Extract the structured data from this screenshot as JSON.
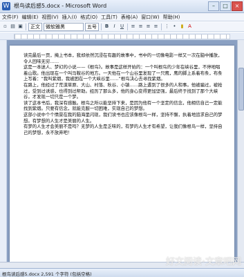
{
  "window": {
    "title": "根鸟读后感5.docx - Microsoft Word",
    "controls": [
      "–",
      "□",
      "×"
    ]
  },
  "menu": [
    "文件(F)",
    "编辑(E)",
    "视图(V)",
    "插入(I)",
    "格式(O)",
    "工具(T)",
    "表格(A)",
    "窗口(W)",
    "帮助(H)"
  ],
  "toolbar": {
    "style_combo": "正文",
    "font_combo": "微软雅黑",
    "size_combo": "五号"
  },
  "document": {
    "paragraphs": [
      "读完最后一页，掩上书本，我却依然沉浸在有趣的故事中，书中的一切像电影一样又一次在脑中播放，令人回味无穷……",
      "这是一本迷人、梦幻的小说——《根鸟》。故事是这样开始的：一个叫根鸟的少年在峡谷里，不停地唱着山歌。他出现在一个叫马鞍谷的地方。一天他在一个山谷里发现了一只鹰，鹰的脚上系着布条，布条上写着：“我叫紫烟，我被困在一个大峡谷里……”根鸟决心去寻找紫烟。",
      "在路上，他经过了荒漠草原、大山、村落、秋谷、小镇……路上遇到了很多的人和事。他被骗过，被抢过，受到过诱惑，也得到过帮助。经历了那么多，他的身心变得更加坚强，最后终于找到了那个大峡谷，才发现一切只是一个梦。",
      "读了这本书后，我深有感触。根鸟之所以能坚持下来，是因为他有一个坚定的信念，他相信自己一定能找到紫烟。只要有信念，就能克服一切困难，实现自己的梦想。",
      "这部小说中个个情景在我的脑海里闪现，我们读书也应该像根鸟一样，坚持不懈，执着地追求自己的梦想。有梦想的人生才是美丽的人生。",
      "有梦的人生才会美丽不是吗？无梦的人生是乏味的，有梦的人生才有希望，让我们像根鸟一样，坚持自己的梦想，永不放弃吧！"
    ]
  },
  "status": {
    "text": "根鸟读后感5.docx  2,591 个字符 (包括空格)"
  },
  "watermark": "好文阅读·文章吧网"
}
